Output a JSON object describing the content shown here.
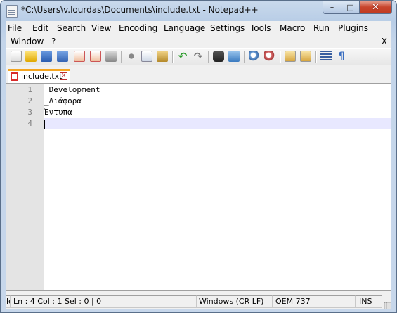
{
  "window": {
    "title": "*C:\\Users\\v.lourdas\\Documents\\include.txt - Notepad++",
    "minimize_glyph": "–",
    "maximize_glyph": "□",
    "close_glyph": "✕"
  },
  "menu": {
    "items": [
      "File",
      "Edit",
      "Search",
      "View",
      "Encoding",
      "Language",
      "Settings",
      "Tools",
      "Macro",
      "Run",
      "Plugins",
      "Window",
      "?"
    ],
    "close_doc": "X"
  },
  "toolbar": {
    "icons": [
      "new-file-icon",
      "open-file-icon",
      "save-icon",
      "save-all-icon",
      "close-icon",
      "close-all-icon",
      "print-icon",
      "cut-icon",
      "copy-icon",
      "paste-icon",
      "undo-icon",
      "redo-icon",
      "find-icon",
      "replace-icon",
      "zoom-in-icon",
      "zoom-out-icon",
      "sync-vertical-icon",
      "sync-horizontal-icon",
      "word-wrap-icon",
      "show-all-chars-icon"
    ]
  },
  "tabs": [
    {
      "label": "include.txt",
      "close_glyph": "✕"
    }
  ],
  "editor": {
    "line_numbers": [
      "1",
      "2",
      "3",
      "4"
    ],
    "lines": [
      "_Development",
      "_Διάφορα",
      "Έντυπα",
      ""
    ],
    "current_line": 4
  },
  "status": {
    "length": "le",
    "position": "Ln : 4    Col : 1    Sel : 0 | 0",
    "eol": "Windows (CR LF)",
    "encoding": "OEM 737",
    "mode": "INS"
  },
  "colors": {
    "tab_accent": "#f4a520",
    "current_line_bg": "#e8e8ff",
    "gutter_bg": "#e4e4e4"
  }
}
